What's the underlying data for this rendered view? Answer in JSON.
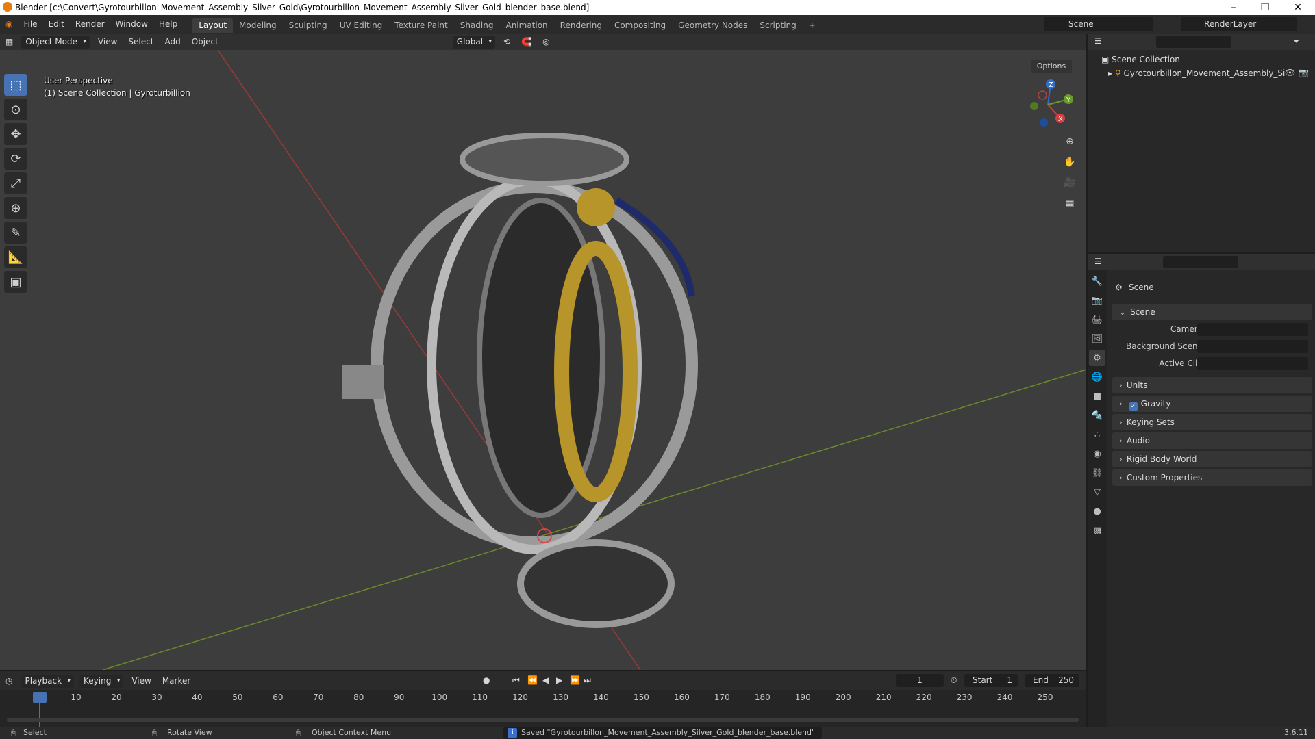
{
  "window": {
    "title": "Blender [c:\\Convert\\Gyrotourbillon_Movement_Assembly_Silver_Gold\\Gyrotourbillon_Movement_Assembly_Silver_Gold_blender_base.blend]"
  },
  "menu": [
    "File",
    "Edit",
    "Render",
    "Window",
    "Help"
  ],
  "workspaces": [
    "Layout",
    "Modeling",
    "Sculpting",
    "UV Editing",
    "Texture Paint",
    "Shading",
    "Animation",
    "Rendering",
    "Compositing",
    "Geometry Nodes",
    "Scripting"
  ],
  "active_workspace": "Layout",
  "scene_selector": "Scene",
  "view_layer": "RenderLayer",
  "viewport": {
    "mode": "Object Mode",
    "menus": [
      "View",
      "Select",
      "Add",
      "Object"
    ],
    "transform_orientation": "Global",
    "options_label": "Options",
    "perspective": "User Perspective",
    "collection_info": "(1) Scene Collection | Gyroturbillion",
    "gizmo": {
      "x": "X",
      "y": "Y",
      "z": "Z"
    }
  },
  "outliner": {
    "root": "Scene Collection",
    "item": "Gyrotourbillon_Movement_Assembly_Si"
  },
  "properties": {
    "context": "Scene",
    "panel_title": "Scene",
    "fields": {
      "camera": "Camera",
      "background_scene": "Background Scene",
      "active_clip": "Active Clip"
    },
    "sections": [
      "Units",
      "Gravity",
      "Keying Sets",
      "Audio",
      "Rigid Body World",
      "Custom Properties"
    ],
    "gravity_checked": true
  },
  "timeline": {
    "menus": [
      "Playback",
      "Keying",
      "View",
      "Marker"
    ],
    "current_frame": "1",
    "start_label": "Start",
    "start": "1",
    "end_label": "End",
    "end": "250",
    "ticks": [
      "1",
      "10",
      "20",
      "30",
      "40",
      "50",
      "60",
      "70",
      "80",
      "90",
      "100",
      "110",
      "120",
      "130",
      "140",
      "150",
      "160",
      "170",
      "180",
      "190",
      "200",
      "210",
      "220",
      "230",
      "240",
      "250"
    ]
  },
  "statusbar": {
    "select": "Select",
    "rotate": "Rotate View",
    "context_menu": "Object Context Menu",
    "message": "Saved \"Gyrotourbillon_Movement_Assembly_Silver_Gold_blender_base.blend\"",
    "version": "3.6.11"
  }
}
